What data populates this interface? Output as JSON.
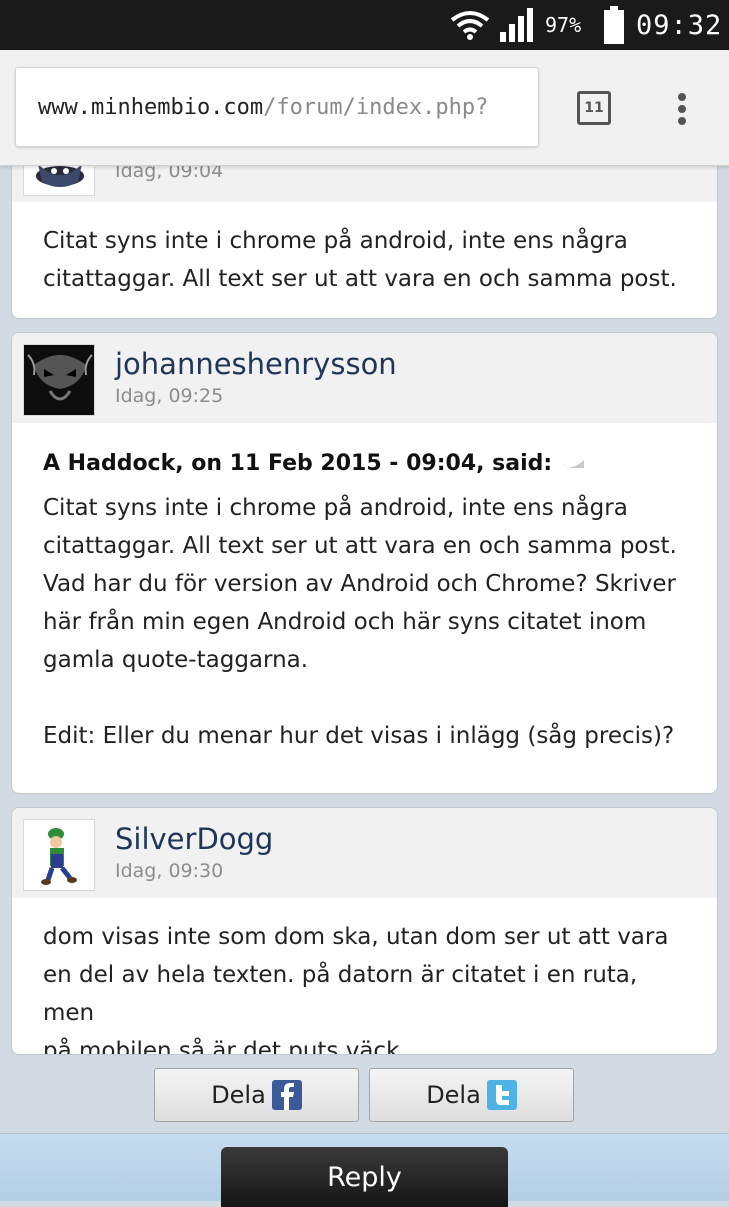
{
  "status_bar": {
    "battery": "97%",
    "time": "09:32"
  },
  "browser": {
    "url_host": "www.minhembio.com",
    "url_path": "/forum/index.php?",
    "tab_count": "11"
  },
  "posts": [
    {
      "date": "Idag, 09:04",
      "lines": [
        "Citat syns inte i chrome på android, inte ens några",
        "citattaggar. All text ser ut att vara en och samma post."
      ]
    },
    {
      "author": "johanneshenrysson",
      "date": "Idag, 09:25",
      "quote_cite": "A Haddock, on 11 Feb 2015 - 09:04, said:",
      "lines": [
        "Citat syns inte i chrome på android, inte ens några",
        "citattaggar. All text ser ut att vara en och samma post.",
        "Vad har du för version av Android och Chrome? Skriver",
        "här från min egen Android och här syns citatet inom",
        "gamla quote-taggarna.",
        "",
        "Edit: Eller du menar hur det visas i inlägg (såg precis)?"
      ]
    },
    {
      "author": "SilverDogg",
      "date": "Idag, 09:30",
      "lines": [
        "dom visas inte som dom ska, utan dom ser ut att vara",
        "en del av hela texten. på datorn är citatet i en ruta, men",
        "på mobilen så är det puts väck."
      ]
    }
  ],
  "share": {
    "facebook_label": "Dela",
    "twitter_label": "Dela"
  },
  "reply_label": "Reply"
}
